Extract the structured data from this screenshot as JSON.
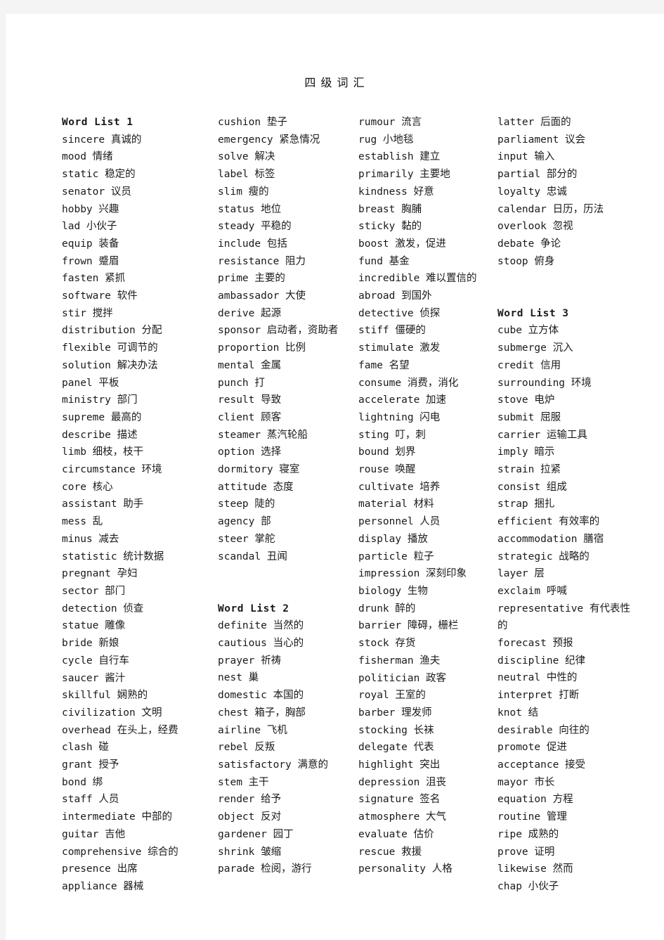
{
  "page": {
    "title": "四 级 词 汇",
    "background": "#ffffff",
    "surround": "#f4f4f4",
    "text_color": "#1a1a1a"
  },
  "columns": [
    {
      "name": "column-1",
      "blocks": [
        {
          "type": "heading",
          "text": "Word List 1"
        },
        {
          "type": "entry",
          "text": "sincere 真诚的"
        },
        {
          "type": "entry",
          "text": "mood 情绪"
        },
        {
          "type": "entry",
          "text": "static 稳定的"
        },
        {
          "type": "entry",
          "text": "senator 议员"
        },
        {
          "type": "entry",
          "text": "hobby 兴趣"
        },
        {
          "type": "entry",
          "text": "lad 小伙子"
        },
        {
          "type": "entry",
          "text": "equip 装备"
        },
        {
          "type": "entry",
          "text": "frown 蹙眉"
        },
        {
          "type": "entry",
          "text": "fasten 紧抓"
        },
        {
          "type": "entry",
          "text": "software 软件"
        },
        {
          "type": "entry",
          "text": "stir 搅拌"
        },
        {
          "type": "entry",
          "text": "distribution 分配"
        },
        {
          "type": "entry",
          "text": "flexible 可调节的"
        },
        {
          "type": "entry",
          "text": "solution 解决办法"
        },
        {
          "type": "entry",
          "text": "panel 平板"
        },
        {
          "type": "entry",
          "text": "ministry 部门"
        },
        {
          "type": "entry",
          "text": "supreme 最高的"
        },
        {
          "type": "entry",
          "text": "describe 描述"
        },
        {
          "type": "entry",
          "text": "limb 细枝，枝干"
        },
        {
          "type": "entry",
          "text": "circumstance 环境"
        },
        {
          "type": "entry",
          "text": "core 核心"
        },
        {
          "type": "entry",
          "text": "assistant 助手"
        },
        {
          "type": "entry",
          "text": "mess 乱"
        },
        {
          "type": "entry",
          "text": "minus 减去"
        },
        {
          "type": "entry",
          "text": "statistic 统计数据"
        },
        {
          "type": "entry",
          "text": "pregnant 孕妇"
        },
        {
          "type": "entry",
          "text": "sector 部门"
        },
        {
          "type": "entry",
          "text": "detection 侦查"
        },
        {
          "type": "entry",
          "text": "statue 雕像"
        },
        {
          "type": "entry",
          "text": "bride 新娘"
        },
        {
          "type": "entry",
          "text": "cycle 自行车"
        },
        {
          "type": "entry",
          "text": "saucer 酱汁"
        },
        {
          "type": "entry",
          "text": "skillful 娴熟的"
        },
        {
          "type": "entry",
          "text": "civilization 文明"
        },
        {
          "type": "entry",
          "text": "overhead 在头上，经费"
        },
        {
          "type": "entry",
          "text": "clash 碰"
        },
        {
          "type": "entry",
          "text": "grant 授予"
        },
        {
          "type": "entry",
          "text": "bond 绑"
        },
        {
          "type": "entry",
          "text": "staff 人员"
        },
        {
          "type": "entry",
          "text": "intermediate 中部的"
        },
        {
          "type": "entry",
          "text": "guitar 吉他"
        },
        {
          "type": "entry",
          "text": "comprehensive 综合的"
        },
        {
          "type": "entry",
          "text": "presence 出席"
        },
        {
          "type": "entry",
          "text": "appliance 器械"
        }
      ]
    },
    {
      "name": "column-2",
      "blocks": [
        {
          "type": "entry",
          "text": "cushion 垫子"
        },
        {
          "type": "entry",
          "text": "emergency 紧急情况"
        },
        {
          "type": "entry",
          "text": "solve 解决"
        },
        {
          "type": "entry",
          "text": "label 标签"
        },
        {
          "type": "entry",
          "text": "slim 瘦的"
        },
        {
          "type": "entry",
          "text": "status 地位"
        },
        {
          "type": "entry",
          "text": "steady 平稳的"
        },
        {
          "type": "entry",
          "text": "include 包括"
        },
        {
          "type": "entry",
          "text": "resistance 阻力"
        },
        {
          "type": "entry",
          "text": "prime 主要的"
        },
        {
          "type": "entry",
          "text": "ambassador 大使"
        },
        {
          "type": "entry",
          "text": "derive 起源"
        },
        {
          "type": "entry",
          "text": "sponsor 启动者，资助者"
        },
        {
          "type": "entry",
          "text": "proportion 比例"
        },
        {
          "type": "entry",
          "text": "mental 金属"
        },
        {
          "type": "entry",
          "text": "punch 打"
        },
        {
          "type": "entry",
          "text": "result 导致"
        },
        {
          "type": "entry",
          "text": "client 顾客"
        },
        {
          "type": "entry",
          "text": "steamer 蒸汽轮船"
        },
        {
          "type": "entry",
          "text": "option 选择"
        },
        {
          "type": "entry",
          "text": "dormitory 寝室"
        },
        {
          "type": "entry",
          "text": "attitude 态度"
        },
        {
          "type": "entry",
          "text": "steep 陡的"
        },
        {
          "type": "entry",
          "text": "agency 部"
        },
        {
          "type": "entry",
          "text": "steer 掌舵"
        },
        {
          "type": "entry",
          "text": "scandal 丑闻"
        },
        {
          "type": "spacer2"
        },
        {
          "type": "heading",
          "text": "Word List 2"
        },
        {
          "type": "entry",
          "text": "definite 当然的"
        },
        {
          "type": "entry",
          "text": "cautious 当心的"
        },
        {
          "type": "entry",
          "text": "prayer 祈祷"
        },
        {
          "type": "entry",
          "text": "nest 巢"
        },
        {
          "type": "entry",
          "text": "domestic 本国的"
        },
        {
          "type": "entry",
          "text": "chest 箱子，胸部"
        },
        {
          "type": "entry",
          "text": "airline 飞机"
        },
        {
          "type": "entry",
          "text": "rebel 反叛"
        },
        {
          "type": "entry",
          "text": "satisfactory 满意的"
        },
        {
          "type": "entry",
          "text": "stem 主干"
        },
        {
          "type": "entry",
          "text": "render 给予"
        },
        {
          "type": "entry",
          "text": "object 反对"
        },
        {
          "type": "entry",
          "text": "gardener 园丁"
        },
        {
          "type": "entry",
          "text": "shrink 皱缩"
        },
        {
          "type": "entry",
          "text": "parade 检阅，游行"
        }
      ]
    },
    {
      "name": "column-3",
      "blocks": [
        {
          "type": "entry",
          "text": "rumour 流言"
        },
        {
          "type": "entry",
          "text": "rug 小地毯"
        },
        {
          "type": "entry",
          "text": "establish 建立"
        },
        {
          "type": "entry",
          "text": "primarily 主要地"
        },
        {
          "type": "entry",
          "text": "kindness 好意"
        },
        {
          "type": "entry",
          "text": "breast 胸脯"
        },
        {
          "type": "entry",
          "text": "sticky 黏的"
        },
        {
          "type": "entry",
          "text": "boost 激发，促进"
        },
        {
          "type": "entry",
          "text": "fund 基金"
        },
        {
          "type": "entry",
          "text": "incredible 难以置信的"
        },
        {
          "type": "entry",
          "text": "abroad 到国外"
        },
        {
          "type": "entry",
          "text": "detective 侦探"
        },
        {
          "type": "entry",
          "text": "stiff 僵硬的"
        },
        {
          "type": "entry",
          "text": "stimulate 激发"
        },
        {
          "type": "entry",
          "text": "fame 名望"
        },
        {
          "type": "entry",
          "text": "consume 消费，消化"
        },
        {
          "type": "entry",
          "text": "accelerate 加速"
        },
        {
          "type": "entry",
          "text": "lightning 闪电"
        },
        {
          "type": "entry",
          "text": "sting 叮，刺"
        },
        {
          "type": "entry",
          "text": "bound 划界"
        },
        {
          "type": "entry",
          "text": "rouse 唤醒"
        },
        {
          "type": "entry",
          "text": "cultivate 培养"
        },
        {
          "type": "entry",
          "text": "material 材料"
        },
        {
          "type": "entry",
          "text": "personnel 人员"
        },
        {
          "type": "entry",
          "text": "display 播放"
        },
        {
          "type": "entry",
          "text": "particle 粒子"
        },
        {
          "type": "entry",
          "text": "impression 深刻印象"
        },
        {
          "type": "entry",
          "text": "biology 生物"
        },
        {
          "type": "entry",
          "text": "drunk 醉的"
        },
        {
          "type": "entry",
          "text": "barrier 障碍，栅栏"
        },
        {
          "type": "entry",
          "text": "stock 存货"
        },
        {
          "type": "entry",
          "text": "fisherman 渔夫"
        },
        {
          "type": "entry",
          "text": "politician 政客"
        },
        {
          "type": "entry",
          "text": "royal 王室的"
        },
        {
          "type": "entry",
          "text": "barber 理发师"
        },
        {
          "type": "entry",
          "text": "stocking 长袜"
        },
        {
          "type": "entry",
          "text": "delegate 代表"
        },
        {
          "type": "entry",
          "text": "highlight 突出"
        },
        {
          "type": "entry",
          "text": "depression 沮丧"
        },
        {
          "type": "entry",
          "text": "signature 签名"
        },
        {
          "type": "entry",
          "text": "atmosphere 大气"
        },
        {
          "type": "entry",
          "text": "evaluate 估价"
        },
        {
          "type": "entry",
          "text": "rescue 救援"
        },
        {
          "type": "entry",
          "text": "personality 人格"
        }
      ]
    },
    {
      "name": "column-4",
      "blocks": [
        {
          "type": "entry",
          "text": "latter 后面的"
        },
        {
          "type": "entry",
          "text": "parliament 议会"
        },
        {
          "type": "entry",
          "text": "input 输入"
        },
        {
          "type": "entry",
          "text": "partial 部分的"
        },
        {
          "type": "entry",
          "text": "loyalty 忠诚"
        },
        {
          "type": "entry",
          "text": "calendar 日历，历法"
        },
        {
          "type": "entry",
          "text": "overlook 忽视"
        },
        {
          "type": "entry",
          "text": "debate 争论"
        },
        {
          "type": "entry",
          "text": "stoop 俯身"
        },
        {
          "type": "spacer2"
        },
        {
          "type": "heading",
          "text": "Word List 3"
        },
        {
          "type": "entry",
          "text": "cube 立方体"
        },
        {
          "type": "entry",
          "text": "submerge 沉入"
        },
        {
          "type": "entry",
          "text": "credit 信用"
        },
        {
          "type": "entry",
          "text": "surrounding 环境"
        },
        {
          "type": "entry",
          "text": "stove 电炉"
        },
        {
          "type": "entry",
          "text": "submit 屈服"
        },
        {
          "type": "entry",
          "text": "carrier 运输工具"
        },
        {
          "type": "entry",
          "text": "imply 暗示"
        },
        {
          "type": "entry",
          "text": "strain 拉紧"
        },
        {
          "type": "entry",
          "text": "consist 组成"
        },
        {
          "type": "entry",
          "text": "strap 捆扎"
        },
        {
          "type": "entry",
          "text": "efficient 有效率的"
        },
        {
          "type": "entry",
          "text": "accommodation 膳宿"
        },
        {
          "type": "entry",
          "text": "strategic 战略的"
        },
        {
          "type": "entry",
          "text": "layer 层"
        },
        {
          "type": "entry",
          "text": "exclaim 呼喊"
        },
        {
          "type": "entry",
          "text": "representative 有代表性的"
        },
        {
          "type": "entry",
          "text": "forecast 预报"
        },
        {
          "type": "entry",
          "text": "discipline 纪律"
        },
        {
          "type": "entry",
          "text": "neutral 中性的"
        },
        {
          "type": "entry",
          "text": "interpret 打断"
        },
        {
          "type": "entry",
          "text": "knot 结"
        },
        {
          "type": "entry",
          "text": "desirable 向往的"
        },
        {
          "type": "entry",
          "text": "promote 促进"
        },
        {
          "type": "entry",
          "text": "acceptance 接受"
        },
        {
          "type": "entry",
          "text": "mayor 市长"
        },
        {
          "type": "entry",
          "text": "equation 方程"
        },
        {
          "type": "entry",
          "text": "routine 管理"
        },
        {
          "type": "entry",
          "text": "ripe 成熟的"
        },
        {
          "type": "entry",
          "text": "prove 证明"
        },
        {
          "type": "entry",
          "text": "likewise 然而"
        },
        {
          "type": "entry",
          "text": "chap 小伙子"
        }
      ]
    }
  ]
}
